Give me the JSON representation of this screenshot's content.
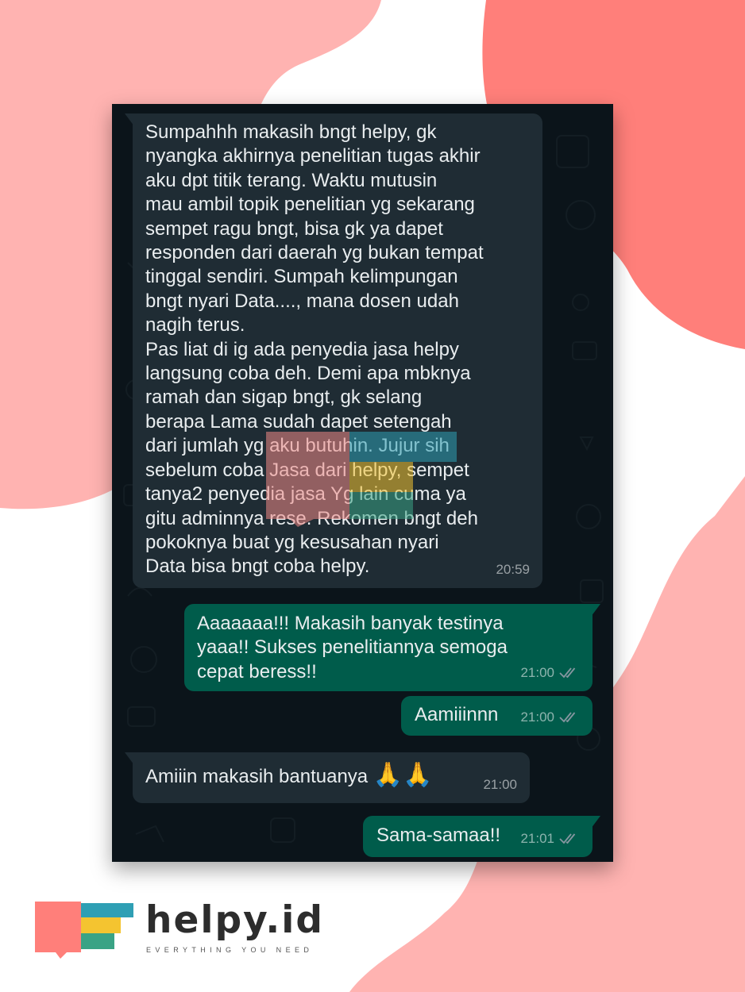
{
  "messages": [
    {
      "direction": "incoming",
      "text": "Sumpahhh  makasih  bngt  helpy, gk\nnyangka  akhirnya  penelitian  tugas  akhir\naku  dpt  titik  terang. Waktu mutusin\nmau  ambil topik penelitian  yg  sekarang\nsempet  ragu  bngt, bisa  gk  ya dapet\nresponden dari  daerah yg  bukan tempat\ntinggal  sendiri. Sumpah kelimpungan\nbngt  nyari  Data...., mana  dosen  udah\nnagih  terus.\n Pas  liat  di  ig  ada  penyedia  jasa helpy\nlangsung  coba  deh. Demi  apa  mbknya\nramah  dan  sigap  bngt, gk  selang\nberapa  Lama  sudah  dapet  setengah\ndari  jumlah  yg  aku  butuhin. Jujur  sih\nsebelum  coba Jasa  dari helpy,  sempet\ntanya2 penyedia jasa Yg  lain  cuma ya\ngitu  adminnya  rese. Rekomen  bngt  deh\npokoknya  buat  yg  kesusahan  nyari\nData  bisa  bngt  coba  helpy.",
      "time": "20:59"
    },
    {
      "direction": "outgoing",
      "text": "Aaaaaaa!!! Makasih banyak testinya\nyaaa!! Sukses penelitiannya semoga\ncepat beress!!",
      "time": "21:00",
      "status_icon": "double-check-icon"
    },
    {
      "direction": "outgoing",
      "text": "Aamiiinnn",
      "time": "21:00",
      "status_icon": "double-check-icon"
    },
    {
      "direction": "incoming",
      "text": "Amiiin  makasih  bantuanya",
      "emoji": "🙏🙏",
      "time": "21:00"
    },
    {
      "direction": "outgoing",
      "text": "Sama-samaa!!",
      "time": "21:01",
      "status_icon": "double-check-icon"
    }
  ],
  "brand": {
    "name": "helpy.id",
    "tagline": "EVERYTHING YOU NEED"
  },
  "colors": {
    "incoming_bubble": "#1f2c34",
    "outgoing_bubble": "#005c4b",
    "chat_background": "#0b141a",
    "blob_light": "#ffb3b1",
    "blob_dark": "#ff7f7a",
    "check_color": "#8696a0"
  }
}
